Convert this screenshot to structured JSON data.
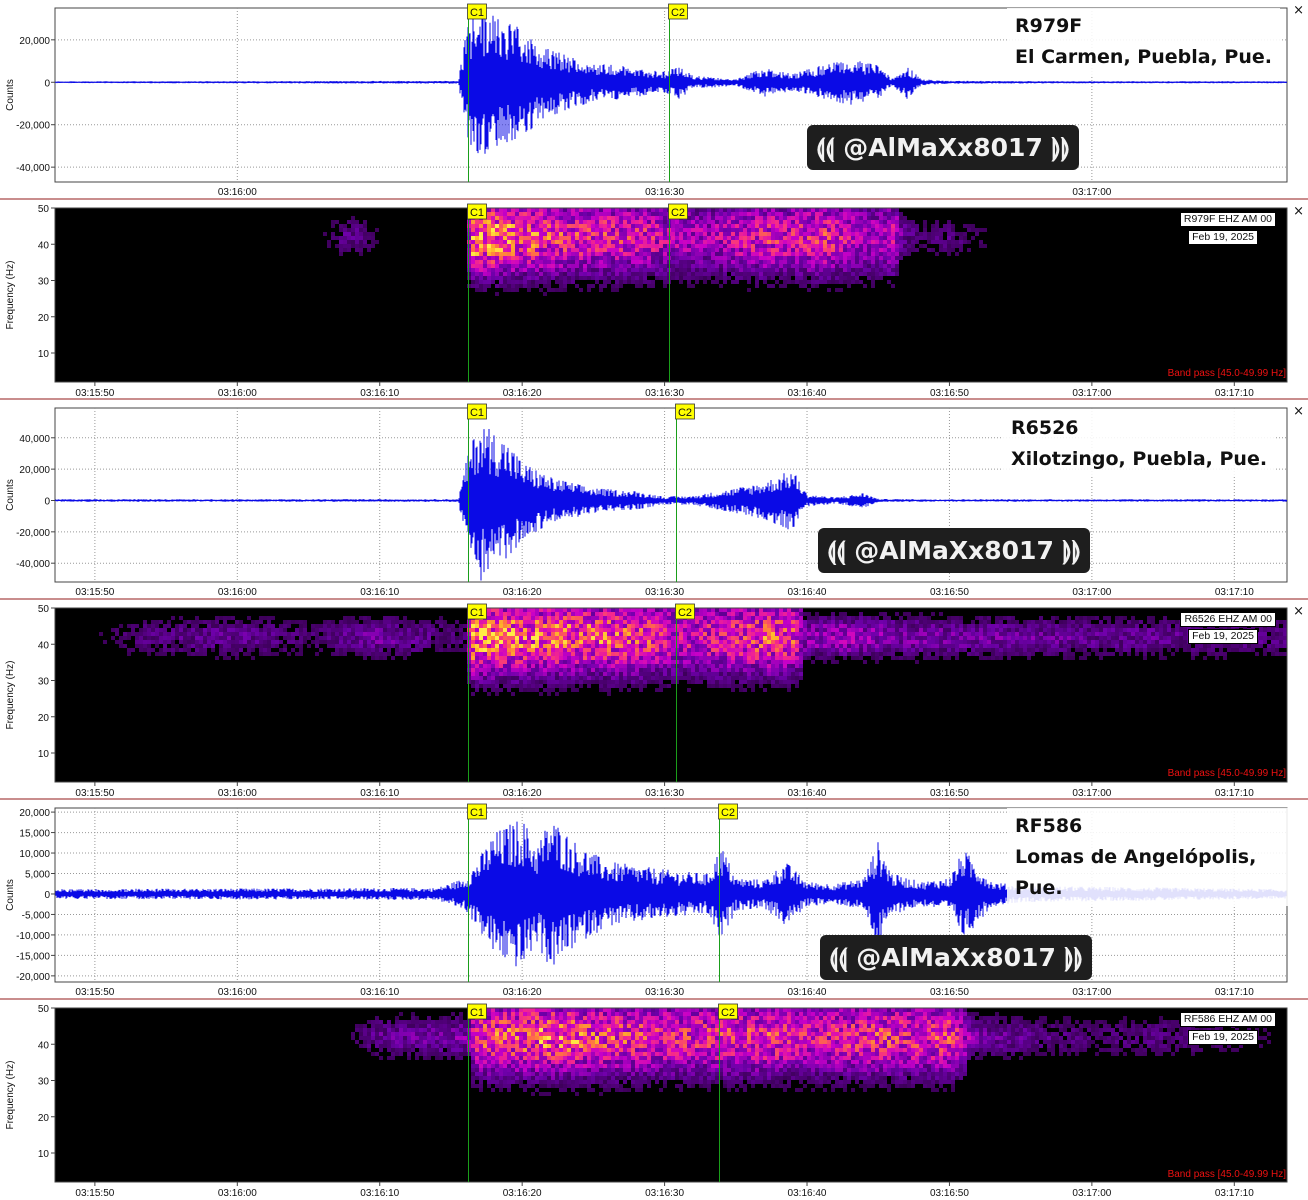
{
  "ui": {
    "close_glyph": "×",
    "seismo_color": "#0a0ae6",
    "marker_line_color": "#1a9e1a",
    "marker_fill": "#ffff00"
  },
  "panels": [
    {
      "station": "R979F",
      "location": "El Carmen, Puebla, Pue.",
      "watermark": "⟬⟬ @AlMaXx8017 ⟭⟭",
      "info": "R979F EHZ AM 00",
      "date": "Feb 19, 2025",
      "band": "Band pass [45.0-49.99 Hz]"
    },
    {
      "station": "R6526",
      "location": "Xilotzingo, Puebla, Pue.",
      "watermark": "⟬⟬ @AlMaXx8017 ⟭⟭",
      "info": "R6526 EHZ AM 00",
      "date": "Feb 19, 2025",
      "band": "Band pass [45.0-49.99 Hz]"
    },
    {
      "station": "RF586",
      "location": "Lomas de Angelópolis, Pue.",
      "watermark": "⟬⟬ @AlMaXx8017 ⟭⟭",
      "info": "RF586 EHZ AM 00",
      "date": "Feb 19, 2025",
      "band": "Band pass [45.0-49.99 Hz]"
    }
  ],
  "chart_data": [
    {
      "type": "line",
      "subtype": "seismogram",
      "station": "R979F",
      "ylabel": "Counts",
      "ylim": [
        -47000,
        35000
      ],
      "yticks": [
        -40000,
        -20000,
        0,
        20000
      ],
      "ytick_labels": [
        "-40,000",
        "-20,000",
        "0",
        "20,000"
      ],
      "xlim_s": [
        -12.8,
        73.7
      ],
      "xticks_s": [
        0,
        30,
        60
      ],
      "xtick_labels": [
        "03:16:00",
        "03:16:30",
        "03:17:00"
      ],
      "markers": [
        {
          "label": "C1",
          "t": 16.2
        },
        {
          "label": "C2",
          "t": 30.3
        }
      ],
      "envelope": {
        "t": [
          -12.8,
          15.5,
          16.2,
          17,
          18,
          20,
          22,
          25,
          27,
          30,
          31,
          32,
          35,
          37,
          39,
          41,
          43,
          45,
          46,
          47,
          48,
          50,
          55,
          60,
          73.7
        ],
        "amp": [
          400,
          700,
          30000,
          35000,
          33000,
          25000,
          16000,
          9000,
          8000,
          5000,
          8000,
          3000,
          1800,
          7000,
          4000,
          8000,
          11000,
          8000,
          1500,
          8000,
          1500,
          700,
          600,
          500,
          500
        ]
      }
    },
    {
      "type": "heatmap",
      "subtype": "spectrogram",
      "station": "R979F",
      "ylabel": "Frequency (Hz)",
      "ylim": [
        2,
        50
      ],
      "yticks": [
        10,
        20,
        30,
        40,
        50
      ],
      "xlim_s": [
        -12.8,
        73.7
      ],
      "xticks_s": [
        -10,
        0,
        10,
        20,
        30,
        40,
        50,
        60,
        70
      ],
      "xtick_labels": [
        "03:15:50",
        "03:16:00",
        "03:16:10",
        "03:16:20",
        "03:16:30",
        "03:16:40",
        "03:16:50",
        "03:17:00",
        "03:17:10"
      ],
      "markers": [
        {
          "label": "C1",
          "t": 16.2
        },
        {
          "label": "C2",
          "t": 30.3
        }
      ],
      "energy": {
        "t": [
          -12.8,
          5,
          8,
          10,
          14,
          16,
          16.5,
          18,
          20,
          23,
          26,
          29,
          30,
          33,
          35,
          37,
          39,
          41,
          43,
          45,
          46,
          47,
          48,
          50,
          53,
          60,
          73.7
        ],
        "level": [
          0,
          0,
          0.3,
          0.1,
          0.05,
          0.1,
          1.0,
          0.95,
          0.85,
          0.75,
          0.7,
          0.65,
          0.55,
          0.5,
          0.6,
          0.7,
          0.65,
          0.75,
          0.6,
          0.5,
          0.6,
          0.3,
          0.2,
          0.25,
          0.1,
          0.05,
          0
        ]
      },
      "low_freq_hz": 17
    },
    {
      "type": "line",
      "subtype": "seismogram",
      "station": "R6526",
      "ylabel": "Counts",
      "ylim": [
        -52000,
        59000
      ],
      "yticks": [
        -40000,
        -20000,
        0,
        20000,
        40000
      ],
      "ytick_labels": [
        "-40,000",
        "-20,000",
        "0",
        "20,000",
        "40,000"
      ],
      "xlim_s": [
        -12.8,
        73.7
      ],
      "xticks_s": [
        -10,
        0,
        10,
        20,
        30,
        40,
        50,
        60,
        70
      ],
      "xtick_labels": [
        "03:15:50",
        "03:16:00",
        "03:16:10",
        "03:16:20",
        "03:16:30",
        "03:16:40",
        "03:16:50",
        "03:17:00",
        "03:17:10"
      ],
      "markers": [
        {
          "label": "C1",
          "t": 16.2
        },
        {
          "label": "C2",
          "t": 30.8
        }
      ],
      "envelope": {
        "t": [
          -12.8,
          15.5,
          16.2,
          17,
          18,
          19,
          20,
          22,
          25,
          28,
          30,
          32,
          35,
          37,
          39,
          40,
          42,
          44,
          45,
          50,
          60,
          73.7
        ],
        "amp": [
          800,
          900,
          30000,
          52000,
          45000,
          38000,
          25000,
          15000,
          8000,
          6000,
          2500,
          3000,
          8000,
          12000,
          20000,
          4000,
          2000,
          5000,
          1000,
          800,
          800,
          800
        ]
      }
    },
    {
      "type": "heatmap",
      "subtype": "spectrogram",
      "station": "R6526",
      "ylabel": "Frequency (Hz)",
      "ylim": [
        2,
        50
      ],
      "yticks": [
        10,
        20,
        30,
        40,
        50
      ],
      "xlim_s": [
        -12.8,
        73.7
      ],
      "xticks_s": [
        -10,
        0,
        10,
        20,
        30,
        40,
        50,
        60,
        70
      ],
      "xtick_labels": [
        "03:15:50",
        "03:16:00",
        "03:16:10",
        "03:16:20",
        "03:16:30",
        "03:16:40",
        "03:16:50",
        "03:17:00",
        "03:17:10"
      ],
      "markers": [
        {
          "label": "C1",
          "t": 16.2
        },
        {
          "label": "C2",
          "t": 30.8
        }
      ],
      "energy": {
        "t": [
          -12.8,
          -6,
          0,
          5,
          10,
          12,
          16,
          16.5,
          18,
          20,
          24,
          28,
          30,
          31,
          34,
          37,
          39,
          40,
          43,
          46,
          50,
          55,
          60,
          65,
          73.7
        ],
        "level": [
          0,
          0.25,
          0.3,
          0.2,
          0.35,
          0.3,
          0.2,
          1.0,
          0.95,
          0.9,
          0.85,
          0.8,
          0.7,
          0.6,
          0.7,
          0.8,
          0.75,
          0.45,
          0.5,
          0.4,
          0.35,
          0.35,
          0.3,
          0.3,
          0.25
        ]
      },
      "low_freq_hz": 17
    },
    {
      "type": "line",
      "subtype": "seismogram",
      "station": "RF586",
      "ylabel": "Counts",
      "ylim": [
        -21500,
        21000
      ],
      "yticks": [
        -20000,
        -15000,
        -10000,
        -5000,
        0,
        5000,
        10000,
        15000,
        20000
      ],
      "ytick_labels": [
        "-20,000",
        "-15,000",
        "-10,000",
        "-5,000",
        "0",
        "5,000",
        "10,000",
        "15,000",
        "20,000"
      ],
      "xlim_s": [
        -12.8,
        73.7
      ],
      "xticks_s": [
        -10,
        0,
        10,
        20,
        30,
        40,
        50,
        60,
        70
      ],
      "xtick_labels": [
        "03:15:50",
        "03:16:00",
        "03:16:10",
        "03:16:20",
        "03:16:30",
        "03:16:40",
        "03:16:50",
        "03:17:00",
        "03:17:10"
      ],
      "markers": [
        {
          "label": "C1",
          "t": 16.2
        },
        {
          "label": "C2",
          "t": 33.8
        }
      ],
      "envelope": {
        "t": [
          -12.8,
          14,
          16,
          17,
          18,
          20,
          21,
          22,
          24,
          26,
          28,
          30,
          33,
          34,
          35,
          37,
          38.5,
          40,
          42,
          44,
          45,
          46,
          48,
          50,
          51,
          53,
          55,
          73.7
        ],
        "amp": [
          1200,
          1500,
          4000,
          9000,
          15000,
          19000,
          12000,
          19000,
          12000,
          8000,
          7000,
          6000,
          5000,
          12000,
          4000,
          3500,
          8000,
          3000,
          2500,
          4000,
          13000,
          5000,
          3000,
          4000,
          11000,
          3000,
          2000,
          1200
        ]
      }
    },
    {
      "type": "heatmap",
      "subtype": "spectrogram",
      "station": "RF586",
      "ylabel": "Frequency (Hz)",
      "ylim": [
        2,
        50
      ],
      "yticks": [
        10,
        20,
        30,
        40,
        50
      ],
      "xlim_s": [
        -12.8,
        73.7
      ],
      "xticks_s": [
        -10,
        0,
        10,
        20,
        30,
        40,
        50,
        60,
        70
      ],
      "xtick_labels": [
        "03:15:50",
        "03:16:00",
        "03:16:10",
        "03:16:20",
        "03:16:30",
        "03:16:40",
        "03:16:50",
        "03:17:00",
        "03:17:10"
      ],
      "markers": [
        {
          "label": "C1",
          "t": 16.2
        },
        {
          "label": "C2",
          "t": 33.8
        }
      ],
      "energy": {
        "t": [
          -12.8,
          7,
          10,
          14,
          16,
          17,
          20,
          22,
          25,
          28,
          30,
          33,
          35,
          38,
          40,
          43,
          45,
          48,
          50,
          52,
          55,
          60,
          65,
          73.7
        ],
        "level": [
          0,
          0.05,
          0.3,
          0.35,
          0.4,
          0.75,
          0.85,
          0.9,
          0.8,
          0.75,
          0.7,
          0.7,
          0.75,
          0.75,
          0.65,
          0.7,
          0.75,
          0.7,
          0.75,
          0.35,
          0.3,
          0.2,
          0.25,
          0.1
        ]
      },
      "low_freq_hz": 24
    }
  ]
}
